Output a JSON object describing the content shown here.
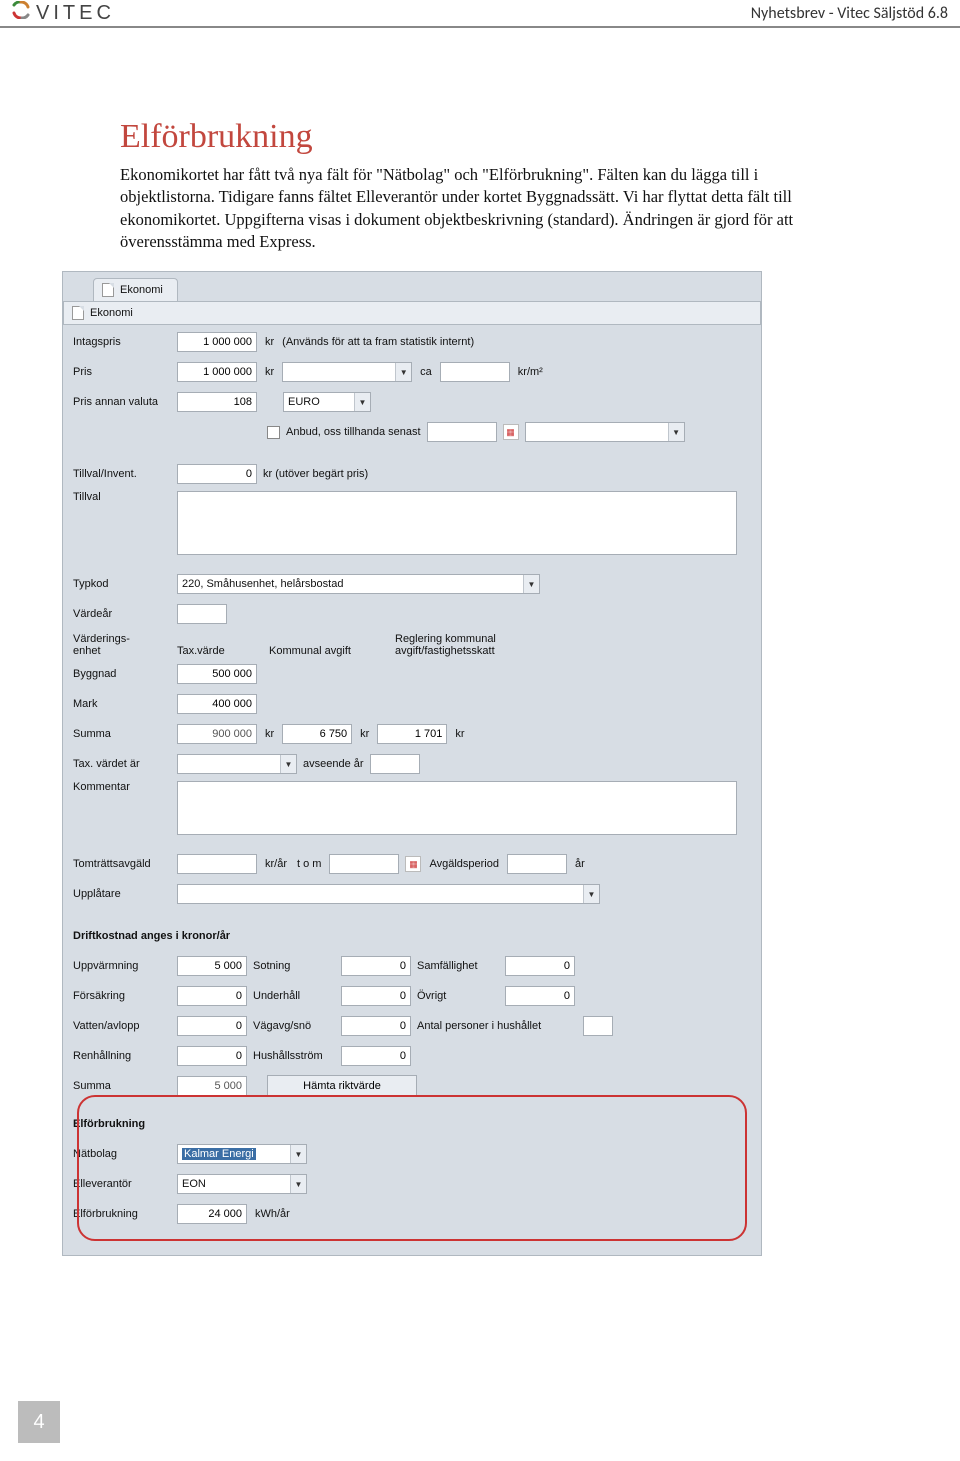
{
  "header": {
    "brand": "VITEC",
    "right": "Nyhetsbrev - Vitec Säljstöd 6.8"
  },
  "title": "Elförbrukning",
  "body1": "Ekonomikortet har fått två nya fält för \"Nätbolag\" och \"Elförbrukning\". Fälten kan du lägga till i objektlistorna. Tidigare fanns fältet Elleverantör under kortet Byggnadssätt. Vi har flyttat detta fält till ekonomikortet. Uppgifterna visas i dokument objektbeskrivning (standard). Ändringen är gjord för att överensstämma med Express.",
  "app": {
    "tab": "Ekonomi",
    "section": "Ekonomi",
    "rows": {
      "intagspris_label": "Intagspris",
      "intagspris_value": "1 000 000",
      "kr": "kr",
      "intagspris_hint": "(Används för att ta fram statistik internt)",
      "pris_label": "Pris",
      "pris_value": "1 000 000",
      "ca": "ca",
      "kr_m2": "kr/m²",
      "pris_annan_label": "Pris annan valuta",
      "pris_annan_value": "108",
      "euro": "EURO",
      "anbud_label": "Anbud, oss tillhanda senast",
      "tillval_invent_label": "Tillval/Invent.",
      "tillval_invent_value": "0",
      "tillval_invent_hint": "kr (utöver begärt pris)",
      "tillval_label": "Tillval",
      "typkod_label": "Typkod",
      "typkod_value": "220, Småhusenhet, helårsbostad",
      "vardear_label": "Värdeår",
      "varderings_label": "Värderings-\nenhet",
      "taxvarde_label": "Tax.värde",
      "kommunal_label": "Kommunal avgift",
      "reglering_label": "Reglering kommunal avgift/fastighetsskatt",
      "byggnad_label": "Byggnad",
      "byggnad_value": "500 000",
      "mark_label": "Mark",
      "mark_value": "400 000",
      "summa_label": "Summa",
      "summa_value": "900 000",
      "kommunal_value": "6 750",
      "reglering_value": "1 701",
      "taxvardet_label": "Tax. värdet är",
      "avseende_label": "avseende år",
      "kommentar_label": "Kommentar",
      "tomtratt_label": "Tomträttsavgäld",
      "kr_ar": "kr/år",
      "tom_label": "t o m",
      "avgaldsperiod_label": "Avgäldsperiod",
      "ar": "år",
      "upplatare_label": "Upplåtare",
      "drift_header": "Driftkostnad anges i kronor/år",
      "uppvarmning_label": "Uppvärmning",
      "uppvarmning_value": "5 000",
      "sotning_label": "Sotning",
      "sotning_value": "0",
      "samfallighet_label": "Samfällighet",
      "samfallighet_value": "0",
      "forsakring_label": "Försäkring",
      "forsakring_value": "0",
      "underhall_label": "Underhåll",
      "underhall_value": "0",
      "ovrigt_label": "Övrigt",
      "ovrigt_value": "0",
      "vatten_label": "Vatten/avlopp",
      "vatten_value": "0",
      "vagavg_label": "Vägavg/snö",
      "vagavg_value": "0",
      "antal_label": "Antal personer i hushållet",
      "renhallning_label": "Renhållning",
      "renhallning_value": "0",
      "hushall_label": "Hushållsström",
      "hushall_value": "0",
      "drift_summa_label": "Summa",
      "drift_summa_value": "5 000",
      "hamta_label": "Hämta riktvärde",
      "elforbrukning_header": "Elförbrukning",
      "natbolag_label": "Nätbolag",
      "natbolag_value": "Kalmar Energi",
      "elleverantor_label": "Elleverantör",
      "elleverantor_value": "EON",
      "elforbrukning_label": "Elförbrukning",
      "elforbrukning_value": "24 000",
      "kwh_ar": "kWh/år"
    }
  },
  "page": "4"
}
